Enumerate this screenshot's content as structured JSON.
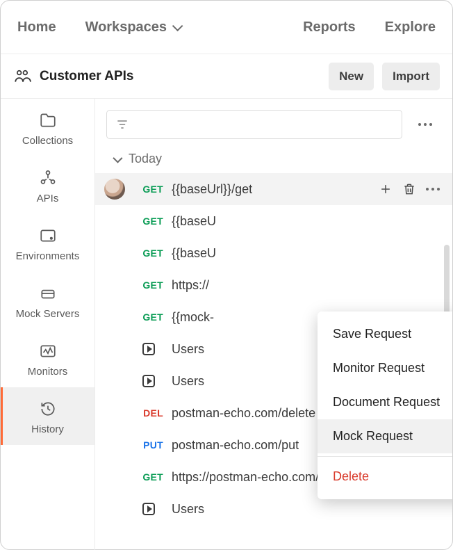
{
  "topnav": {
    "home": "Home",
    "workspaces": "Workspaces",
    "reports": "Reports",
    "explore": "Explore"
  },
  "workspace": {
    "title": "Customer APIs",
    "new_btn": "New",
    "import_btn": "Import"
  },
  "rail": {
    "items": [
      {
        "key": "collections",
        "label": "Collections",
        "active": false
      },
      {
        "key": "apis",
        "label": "APIs",
        "active": false
      },
      {
        "key": "environments",
        "label": "Environments",
        "active": false
      },
      {
        "key": "mockservers",
        "label": "Mock Servers",
        "active": false
      },
      {
        "key": "monitors",
        "label": "Monitors",
        "active": false
      },
      {
        "key": "history",
        "label": "History",
        "active": true
      }
    ]
  },
  "history": {
    "section_label": "Today",
    "rows": [
      {
        "method": "GET",
        "label": "{{baseUrl}}/get",
        "avatar": true,
        "selected": true
      },
      {
        "method": "GET",
        "label": "{{baseU",
        "avatar": false,
        "selected": false
      },
      {
        "method": "GET",
        "label": "{{baseU",
        "avatar": false,
        "selected": false
      },
      {
        "method": "GET",
        "label": "https://",
        "avatar": false,
        "selected": false
      },
      {
        "method": "GET",
        "label": "{{mock-",
        "avatar": false,
        "selected": false
      },
      {
        "method": "RUN",
        "label": "Users",
        "avatar": false,
        "selected": false
      },
      {
        "method": "RUN",
        "label": "Users",
        "avatar": false,
        "selected": false
      },
      {
        "method": "DEL",
        "label": "postman-echo.com/delete",
        "avatar": false,
        "selected": false
      },
      {
        "method": "PUT",
        "label": "postman-echo.com/put",
        "avatar": false,
        "selected": false
      },
      {
        "method": "GET",
        "label": "https://postman-echo.com/get",
        "avatar": false,
        "selected": false
      },
      {
        "method": "RUN",
        "label": "Users",
        "avatar": false,
        "selected": false
      }
    ]
  },
  "context_menu": {
    "items": [
      {
        "label": "Save Request",
        "hover": false,
        "danger": false
      },
      {
        "label": "Monitor Request",
        "hover": false,
        "danger": false
      },
      {
        "label": "Document Request",
        "hover": false,
        "danger": false
      },
      {
        "label": "Mock Request",
        "hover": true,
        "danger": false
      },
      {
        "label": "Delete",
        "hover": false,
        "danger": true
      }
    ],
    "cursor_glyph": "✊"
  }
}
